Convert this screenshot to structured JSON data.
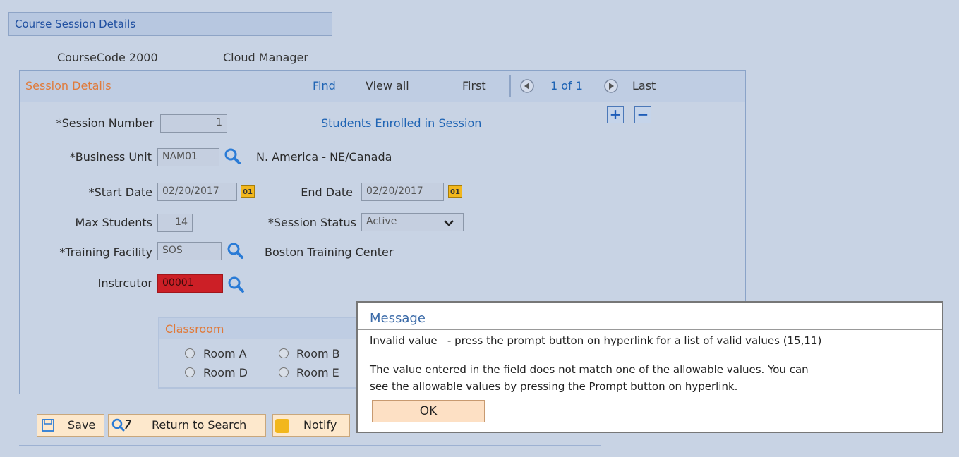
{
  "page": {
    "title": "Course Session Details"
  },
  "course": {
    "code": "CourseCode 2000",
    "name": "Cloud Manager"
  },
  "session_panel": {
    "title": "Session Details",
    "nav": {
      "find": "Find",
      "view_all": "View all",
      "first": "First",
      "count": "1 of 1",
      "last": "Last"
    },
    "students_link": "Students Enrolled in Session"
  },
  "fields": {
    "session_number": {
      "label": "*Session Number",
      "value": "1"
    },
    "business_unit": {
      "label": "*Business Unit",
      "value": "NAM01",
      "description": "N. America - NE/Canada"
    },
    "start_date": {
      "label": "*Start Date",
      "value": "02/20/2017",
      "cal": "01"
    },
    "end_date": {
      "label": "End Date",
      "value": "02/20/2017",
      "cal": "01"
    },
    "max_students": {
      "label": "Max Students",
      "value": "14"
    },
    "session_status": {
      "label": "*Session Status",
      "value": "Active"
    },
    "training_facility": {
      "label": "*Training Facility",
      "value": "SOS",
      "description": "Boston Training Center"
    },
    "instructor": {
      "label": "Instrcutor",
      "value": "00001"
    }
  },
  "classroom": {
    "title": "Classroom",
    "rooms": [
      "Room A",
      "Room B",
      "Room D",
      "Room E"
    ]
  },
  "buttons": {
    "save": "Save",
    "return_to_search": "Return to Search",
    "notify": "Notify"
  },
  "message": {
    "title": "Message",
    "line1": "Invalid value   - press the prompt button on hyperlink for a list of valid values (15,11)",
    "line2": "The value entered in the field does not match one of the allowable values. You can",
    "line3": "see the allowable values by pressing the Prompt button on hyperlink.",
    "ok": "OK"
  },
  "colors": {
    "accent_orange": "#e07a3a",
    "link_blue": "#1f64b4",
    "error_red": "#cc1f26"
  }
}
